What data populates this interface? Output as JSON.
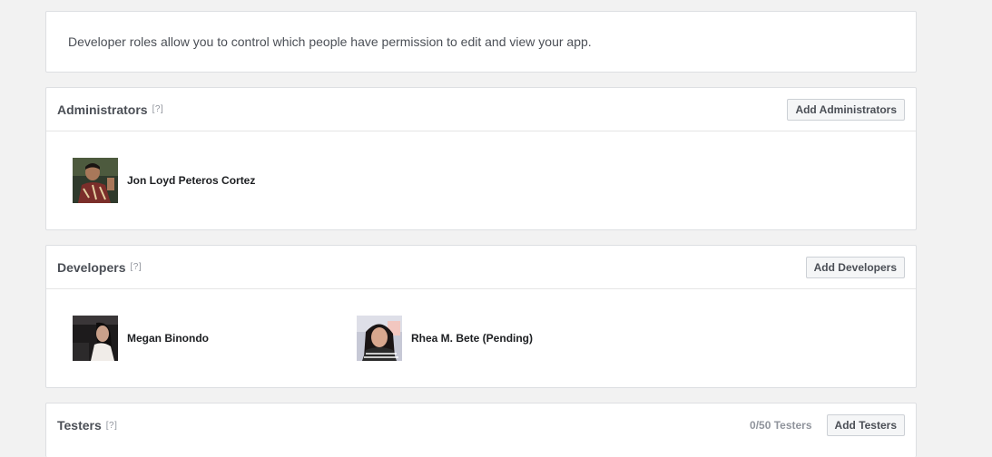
{
  "intro": {
    "text": "Developer roles allow you to control which people have permission to edit and view your app."
  },
  "administrators": {
    "title": "Administrators",
    "help": "[?]",
    "button": "Add Administrators",
    "people": [
      {
        "name": "Jon Loyd Peteros Cortez"
      }
    ]
  },
  "developers": {
    "title": "Developers",
    "help": "[?]",
    "button": "Add Developers",
    "people": [
      {
        "name": "Megan Binondo"
      },
      {
        "name": "Rhea M. Bete (Pending)"
      }
    ]
  },
  "testers": {
    "title": "Testers",
    "help": "[?]",
    "count": "0/50 Testers",
    "button": "Add Testers"
  }
}
